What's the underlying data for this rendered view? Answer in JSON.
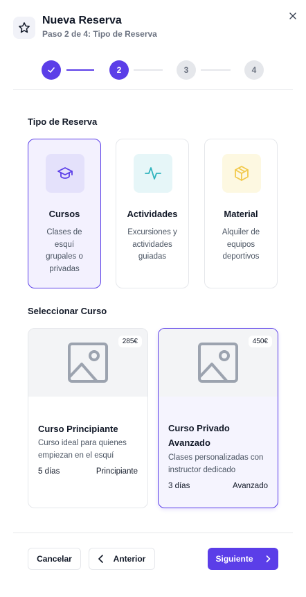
{
  "header": {
    "title": "Nueva Reserva",
    "subtitle": "Paso 2 de 4: Tipo de Reserva",
    "icon": "star-icon",
    "close_icon": "close-icon"
  },
  "stepper": {
    "current": 2,
    "total": 4,
    "steps": [
      {
        "label": "1",
        "state": "done"
      },
      {
        "label": "2",
        "state": "active"
      },
      {
        "label": "3",
        "state": "pending"
      },
      {
        "label": "4",
        "state": "pending"
      }
    ]
  },
  "type_section": {
    "title": "Tipo de Reserva",
    "cards": [
      {
        "title": "Cursos",
        "description": "Clases de esquí grupales o privadas",
        "icon": "graduation-cap-icon",
        "selected": true
      },
      {
        "title": "Actividades",
        "description": "Excursiones y actividades guiadas",
        "icon": "activity-icon",
        "selected": false
      },
      {
        "title": "Material",
        "description": "Alquiler de equipos deportivos",
        "icon": "package-icon",
        "selected": false
      }
    ]
  },
  "course_section": {
    "title": "Seleccionar Curso",
    "courses": [
      {
        "title": "Curso Principiante",
        "price": "285€",
        "description": "Curso ideal para quienes empiezan en el esquí",
        "days": "5 días",
        "level": "Principiante",
        "selected": false
      },
      {
        "title": "Curso Privado Avanzado",
        "price": "450€",
        "description": "Clases personalizadas con instructor dedicado",
        "days": "3 días",
        "level": "Avanzado",
        "selected": true
      }
    ]
  },
  "footer": {
    "cancel_label": "Cancelar",
    "prev_label": "Anterior",
    "next_label": "Siguiente"
  },
  "colors": {
    "accent": "#5b3ee8",
    "accent_light": "#f3f1fe",
    "border": "#e5e7eb",
    "activity_teal": "#2fb3bd",
    "material_yellow": "#f2c94c"
  }
}
